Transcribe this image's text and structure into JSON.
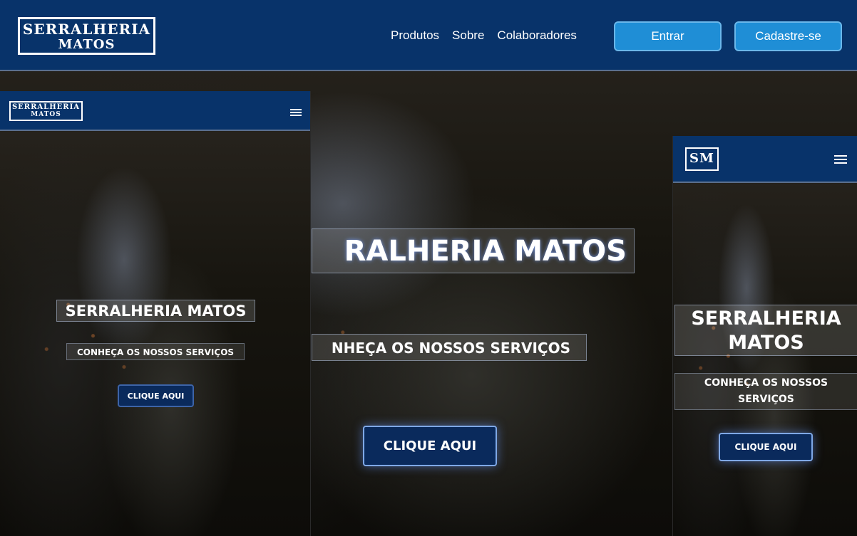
{
  "brand": {
    "line1": "SERRALHERIA",
    "line2": "MATOS",
    "monogram": "SM"
  },
  "nav": {
    "items": [
      "Produtos",
      "Sobre",
      "Colaboradores"
    ],
    "login_label": "Entrar",
    "signup_label": "Cadastre-se"
  },
  "hero": {
    "title": "SERRALHERIA MATOS",
    "desktop_title_visible": "RALHERIA MATOS",
    "subtitle": "CONHEÇA OS NOSSOS SERVIÇOS",
    "desktop_subtitle_visible": "NHEÇA OS NOSSOS SERVIÇOS",
    "mobile_title_lines": [
      "SERRALHERIA",
      "MATOS"
    ],
    "mobile_subtitle_lines": [
      "CONHEÇA OS NOSSOS",
      "SERVIÇOS"
    ],
    "cta_label": "CLIQUE AQUI"
  },
  "colors": {
    "header_navy": "#08336a",
    "button_blue": "#1f8ed6",
    "cta_navy": "#0a2a5c"
  },
  "icons": {
    "menu": "hamburger-menu-icon"
  }
}
